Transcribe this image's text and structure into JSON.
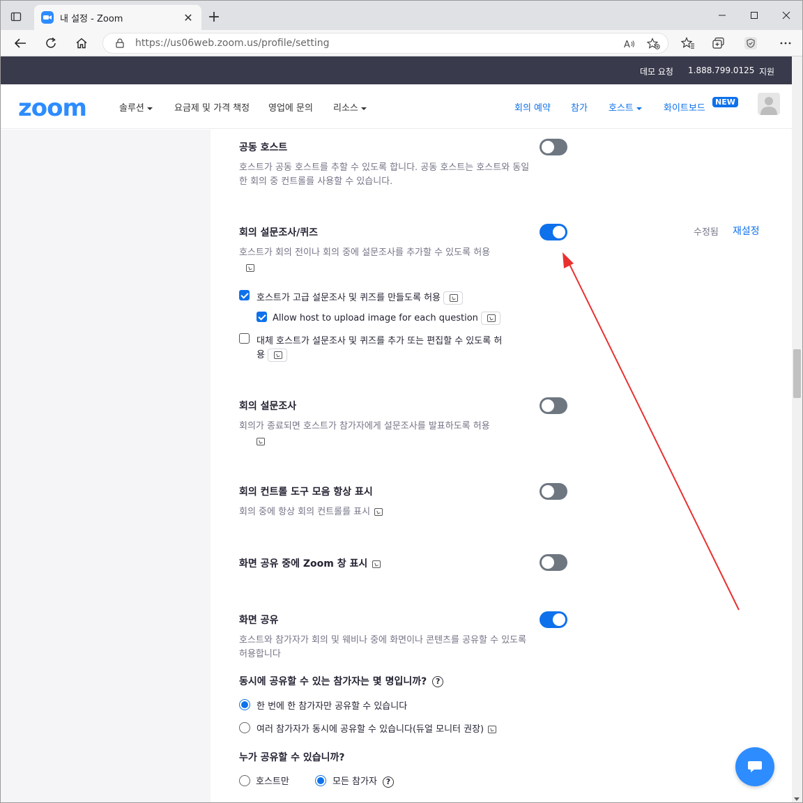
{
  "browser": {
    "tab_title": "내 설정 - Zoom",
    "url_host": "https://us06web.zoom.us",
    "url_path": "/profile/setting"
  },
  "topbar": {
    "demo": "데모 요청",
    "phone": "1.888.799.0125",
    "support": "지원"
  },
  "nav": {
    "logo": "zoom",
    "solutions": "솔루션",
    "plans": "요금제 및 가격 책정",
    "sales": "영업에 문의",
    "resources": "리소스",
    "schedule": "회의 예약",
    "join": "참가",
    "host": "호스트",
    "whiteboard": "화이트보드",
    "new_badge": "NEW"
  },
  "settings": {
    "cohost": {
      "title": "공동 호스트",
      "desc": "호스트가 공동 호스트를 추할 수 있도록 합니다. 공동 호스트는 호스트와 동일한 회의 중 컨트롤를 사용할 수 있습니다.",
      "enabled": false
    },
    "polls": {
      "title": "회의 설문조사/퀴즈",
      "desc": "호스트가 회의 전이나 회의 중에 설문조사를 추가할 수 있도록 허용",
      "enabled": true,
      "modified": "수정됨",
      "reset": "재설정",
      "opt_advanced": "호스트가 고급 설문조사 및 퀴즈를 만들도록 허용",
      "opt_advanced_checked": true,
      "opt_upload": "Allow host to upload image for each question",
      "opt_upload_checked": true,
      "opt_alt_host_1": "대체 호스트가 설문조사 및 퀴즈를 추가 또는 편집할 수 있도록 허",
      "opt_alt_host_2": "용",
      "opt_alt_host_checked": false
    },
    "survey": {
      "title": "회의 설문조사",
      "desc": "회의가 종료되면 호스트가 참가자에게 설문조사를 발표하도록 허용",
      "enabled": false
    },
    "toolbar": {
      "title": "회의 컨트롤 도구 모음 항상 표시",
      "desc": "회의 중에 항상 회의 컨트롤를 표시",
      "enabled": false
    },
    "zoom_window": {
      "title": "화면 공유 중에 Zoom 창 표시",
      "enabled": false
    },
    "screen_share": {
      "title": "화면 공유",
      "desc": "호스트와 참가자가 회의 및 웨비나 중에 화면이나 콘텐츠를 공유할 수 있도록 허용합니다",
      "enabled": true,
      "q1": "동시에 공유할 수 있는 참가자는 몇 명입니까?",
      "q1_opt1": "한 번에 한 참가자만 공유할 수 있습니다",
      "q1_opt2": "여러 참가자가 동시에 공유할 수 있습니다(듀얼 모니터 권장)",
      "q2": "누가 공유할 수 있습니까?",
      "q2_opt1": "호스트만",
      "q2_opt2": "모든 참가자"
    }
  },
  "colors": {
    "accent": "#0e71eb",
    "annotation_arrow": "#e8312f"
  }
}
